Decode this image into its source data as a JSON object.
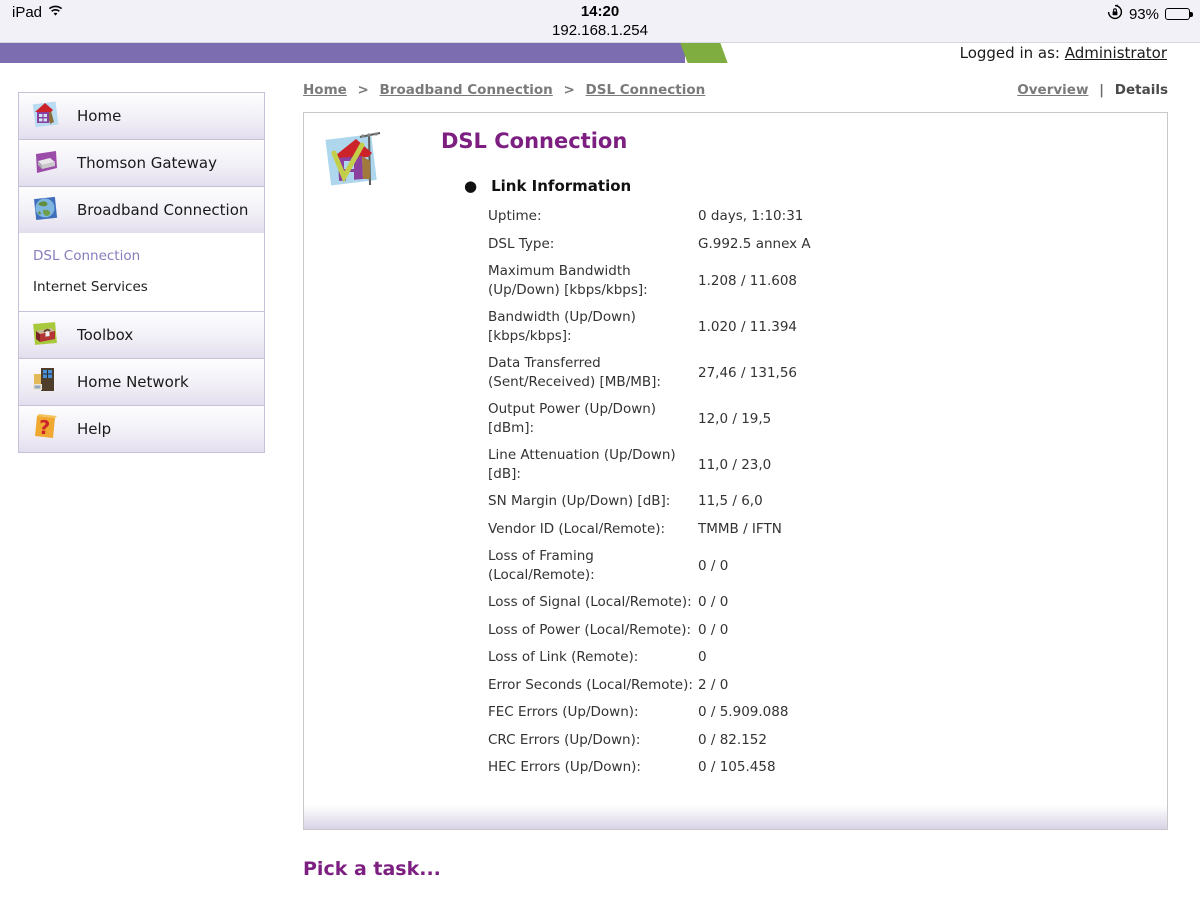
{
  "status_bar": {
    "device": "iPad",
    "time": "14:20",
    "url": "192.168.1.254",
    "battery_percent": "93%"
  },
  "header": {
    "logged_in_label": "Logged in as:",
    "user": "Administrator",
    "bar_purple": "#7c6cb0",
    "bar_green": "#7fad3f"
  },
  "sidebar": {
    "items": [
      {
        "label": "Home",
        "icon": "home-icon"
      },
      {
        "label": "Thomson Gateway",
        "icon": "gateway-icon"
      },
      {
        "label": "Broadband Connection",
        "icon": "broadband-icon"
      },
      {
        "label": "Toolbox",
        "icon": "toolbox-icon"
      },
      {
        "label": "Home Network",
        "icon": "home-network-icon"
      },
      {
        "label": "Help",
        "icon": "help-icon"
      }
    ],
    "submenu": [
      {
        "label": "DSL Connection",
        "active": true
      },
      {
        "label": "Internet Services",
        "active": false
      }
    ]
  },
  "breadcrumb": {
    "separator": ">",
    "items": [
      "Home",
      "Broadband Connection",
      "DSL Connection"
    ]
  },
  "view_switch": {
    "overview": "Overview",
    "divider": "|",
    "details": "Details"
  },
  "content": {
    "title": "DSL Connection",
    "section_title": "Link Information",
    "title_color": "#7c1f80",
    "rows": [
      {
        "label": "Uptime:",
        "value": "0 days, 1:10:31"
      },
      {
        "label": "DSL Type:",
        "value": "G.992.5 annex A"
      },
      {
        "label": "Maximum Bandwidth (Up/Down) [kbps/kbps]:",
        "value": "1.208 / 11.608"
      },
      {
        "label": "Bandwidth (Up/Down) [kbps/kbps]:",
        "value": "1.020 / 11.394"
      },
      {
        "label": "Data Transferred (Sent/Received) [MB/MB]:",
        "value": "27,46 / 131,56"
      },
      {
        "label": "Output Power (Up/Down) [dBm]:",
        "value": "12,0 / 19,5"
      },
      {
        "label": "Line Attenuation (Up/Down) [dB]:",
        "value": "11,0 / 23,0"
      },
      {
        "label": "SN Margin (Up/Down) [dB]:",
        "value": "11,5 / 6,0"
      },
      {
        "label": "Vendor ID (Local/Remote):",
        "value": "TMMB / IFTN"
      },
      {
        "label": "Loss of Framing (Local/Remote):",
        "value": "0 / 0"
      },
      {
        "label": "Loss of Signal (Local/Remote):",
        "value": "0 / 0"
      },
      {
        "label": "Loss of Power (Local/Remote):",
        "value": "0 / 0"
      },
      {
        "label": "Loss of Link (Remote):",
        "value": "0"
      },
      {
        "label": "Error Seconds (Local/Remote):",
        "value": "2 / 0"
      },
      {
        "label": "FEC Errors (Up/Down):",
        "value": "0 / 5.909.088"
      },
      {
        "label": "CRC Errors (Up/Down):",
        "value": "0 / 82.152"
      },
      {
        "label": "HEC Errors (Up/Down):",
        "value": "0 / 105.458"
      }
    ]
  },
  "footer": {
    "pick_task": "Pick a task..."
  }
}
